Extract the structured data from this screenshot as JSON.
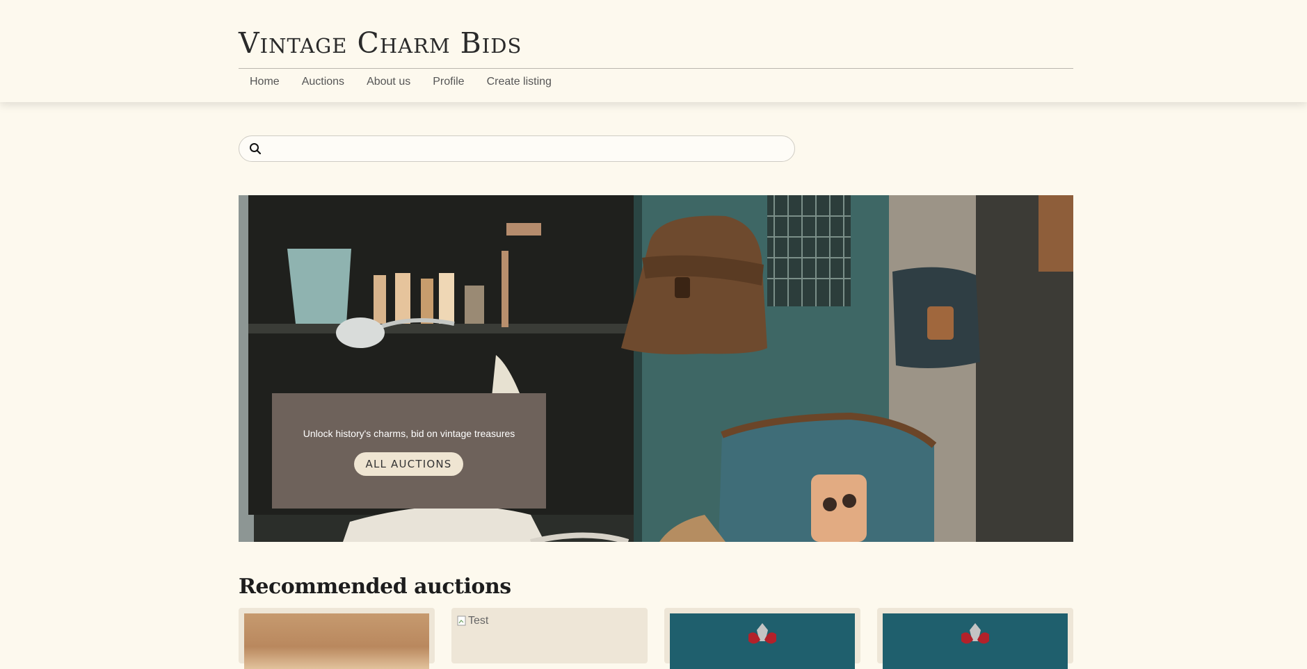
{
  "header": {
    "brand": "Vintage Charm Bids",
    "nav": [
      "Home",
      "Auctions",
      "About us",
      "Profile",
      "Create listing"
    ]
  },
  "search": {
    "placeholder": "",
    "value": ""
  },
  "hero": {
    "tagline": "Unlock history's charms, bid on vintage treasures",
    "button_label": "ALL AUCTIONS"
  },
  "recommended": {
    "title": "Recommended auctions",
    "cards": [
      {
        "image": "vintage-cup-photo"
      },
      {
        "image_alt": "Test"
      },
      {
        "image": "teal-door-ornament-photo"
      },
      {
        "image": "teal-door-ornament-photo"
      }
    ]
  },
  "colors": {
    "background": "#fdf9ee",
    "hero_card": "#6e625b",
    "hero_button": "#efe5d2",
    "card_background": "#eee6d7",
    "teal": "#2f6f78"
  }
}
